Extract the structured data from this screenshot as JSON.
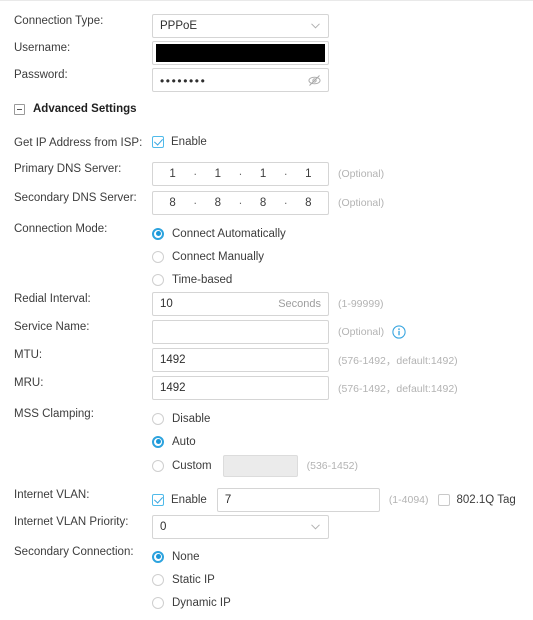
{
  "form": {
    "connection_type": {
      "label": "Connection Type:",
      "value": "PPPoE",
      "icon": "chevron-down-icon"
    },
    "username": {
      "label": "Username:",
      "value": "",
      "redacted": true
    },
    "password": {
      "label": "Password:",
      "value": "••••••••",
      "reveal_icon": "eye-off-icon"
    },
    "advanced_settings": {
      "label": "Advanced Settings",
      "expanded": true,
      "toggle_icon": "minus-square-icon"
    },
    "get_ip_from_isp": {
      "label": "Get IP Address from ISP:",
      "checkbox_label": "Enable",
      "checked": true
    },
    "primary_dns": {
      "label": "Primary DNS Server:",
      "octets": [
        "1",
        "1",
        "1",
        "1"
      ],
      "hint": "(Optional)"
    },
    "secondary_dns": {
      "label": "Secondary DNS Server:",
      "octets": [
        "8",
        "8",
        "8",
        "8"
      ],
      "hint": "(Optional)"
    },
    "connection_mode": {
      "label": "Connection Mode:",
      "options": [
        {
          "label": "Connect Automatically",
          "selected": true
        },
        {
          "label": "Connect Manually",
          "selected": false
        },
        {
          "label": "Time-based",
          "selected": false
        }
      ]
    },
    "redial_interval": {
      "label": "Redial Interval:",
      "value": "10",
      "unit": "Seconds",
      "hint": "(1-99999)"
    },
    "service_name": {
      "label": "Service Name:",
      "value": "",
      "placeholder": "",
      "hint": "(Optional)",
      "info_icon": "info-circle-icon"
    },
    "mtu": {
      "label": "MTU:",
      "value": "1492",
      "hint": "(576-1492，default:1492)"
    },
    "mru": {
      "label": "MRU:",
      "value": "1492",
      "hint": "(576-1492，default:1492)"
    },
    "mss_clamping": {
      "label": "MSS Clamping:",
      "options": [
        {
          "label": "Disable",
          "selected": false
        },
        {
          "label": "Auto",
          "selected": true
        },
        {
          "label": "Custom",
          "selected": false
        }
      ],
      "custom_value": "",
      "custom_hint": "(536-1452)"
    },
    "internet_vlan": {
      "label": "Internet VLAN:",
      "checkbox_label": "Enable",
      "checked": true,
      "value": "7",
      "hint": "(1-4094)",
      "tag_label": "802.1Q Tag",
      "tag_checked": false
    },
    "internet_vlan_priority": {
      "label": "Internet VLAN Priority:",
      "value": "0",
      "icon": "chevron-down-icon"
    },
    "secondary_connection": {
      "label": "Secondary Connection:",
      "options": [
        {
          "label": "None",
          "selected": true
        },
        {
          "label": "Static IP",
          "selected": false
        },
        {
          "label": "Dynamic IP",
          "selected": false
        }
      ]
    }
  },
  "colors": {
    "accent": "#1b97d8",
    "checkbox_border": "#4fbaea",
    "hint_text": "#b3b3b3",
    "label_text": "#3c3c3c",
    "border": "#d5d5d5"
  }
}
